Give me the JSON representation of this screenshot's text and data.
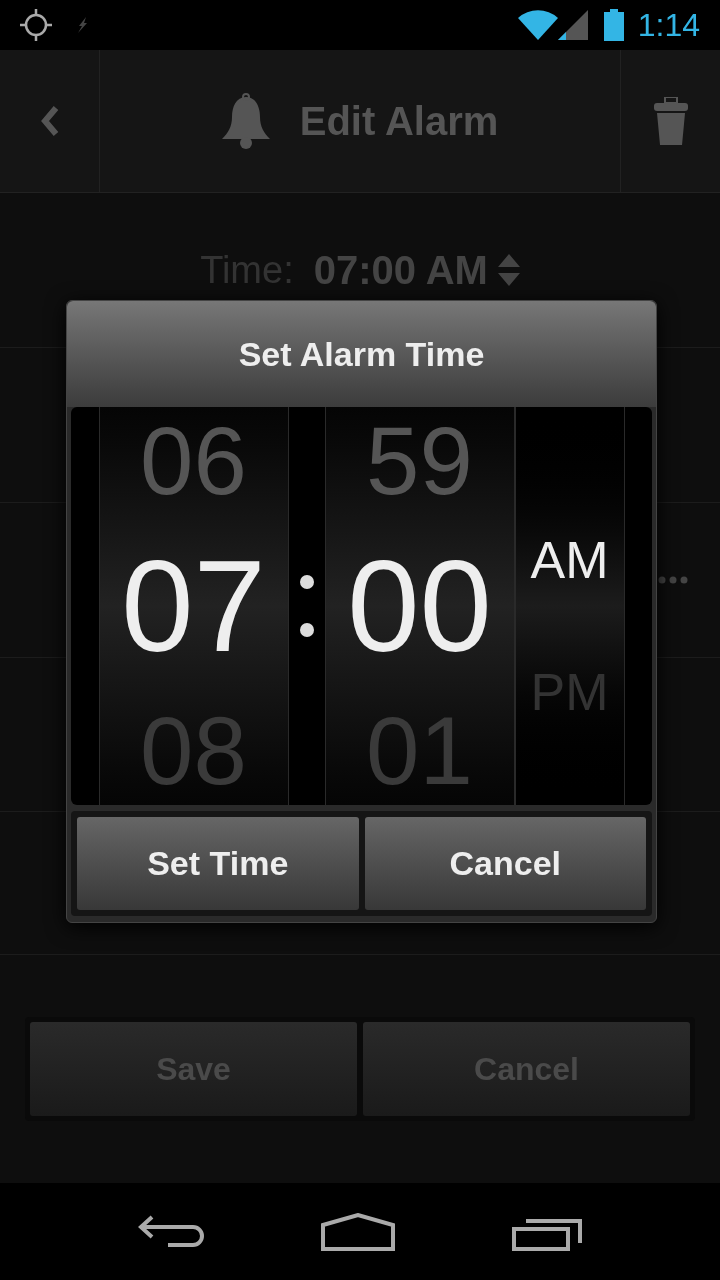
{
  "status_bar": {
    "time": "1:14"
  },
  "header": {
    "title": "Edit Alarm"
  },
  "time_row": {
    "label": "Time:",
    "value": "07:00 AM"
  },
  "dialog": {
    "title": "Set Alarm Time",
    "columns": [
      {
        "kind": "digits",
        "previous": "06",
        "current": "07",
        "next": "08"
      },
      {
        "kind": "separator"
      },
      {
        "kind": "digits",
        "previous": "59",
        "current": "00",
        "next": "01"
      },
      {
        "kind": "period",
        "current": "AM",
        "next": "PM"
      }
    ],
    "buttons": [
      "Set Time",
      "Cancel"
    ]
  },
  "footer_buttons": [
    "Save",
    "Cancel"
  ]
}
